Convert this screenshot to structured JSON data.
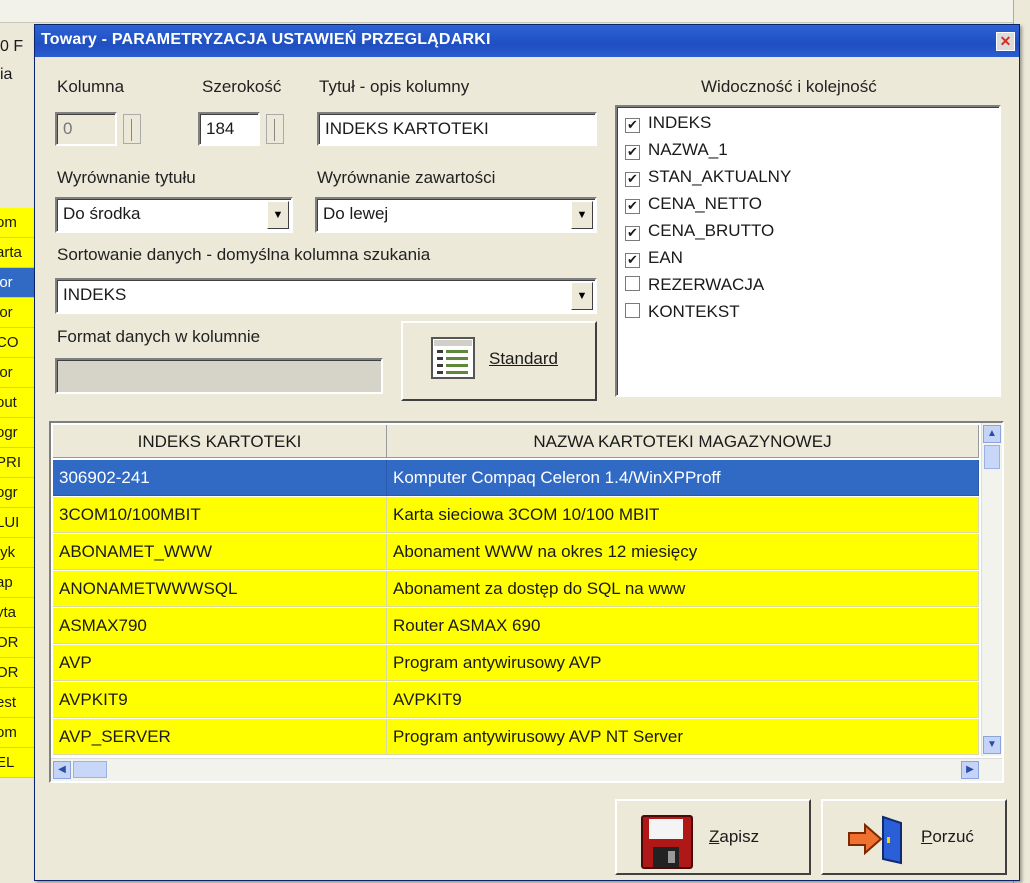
{
  "background": {
    "left_cells": [
      "om",
      "arta",
      "ior",
      "ior",
      "CO",
      "ior",
      "out",
      "ogr",
      "PRI",
      "ogr",
      "LUI",
      "tyk",
      "ap",
      "yta",
      "OR",
      "OR",
      "est",
      "om",
      "EL"
    ],
    "left_top": [
      "0 F",
      "ia"
    ]
  },
  "dialog": {
    "title": "Towary - PARAMETRYZACJA USTAWIEŃ PRZEGLĄDARKI",
    "close_glyph": "✕"
  },
  "form": {
    "kolumna_label": "Kolumna",
    "kolumna_value": "0",
    "szerokosc_label": "Szerokość",
    "szerokosc_value": "184",
    "tytul_label": "Tytuł - opis kolumny",
    "tytul_value": "INDEKS KARTOTEKI",
    "wyrownanie_tytulu_label": "Wyrównanie tytułu",
    "wyrownanie_tytulu_value": "Do środka",
    "wyrownanie_zawartosci_label": "Wyrównanie zawartości",
    "wyrownanie_zawartosci_value": "Do lewej",
    "sortowanie_label": "Sortowanie danych - domyślna kolumna szukania",
    "sortowanie_value": "INDEKS",
    "format_label": "Format danych w kolumnie",
    "format_value": "",
    "standard_button": "Standard"
  },
  "visibility": {
    "label": "Widoczność i kolejność",
    "items": [
      {
        "name": "INDEKS",
        "checked": true
      },
      {
        "name": "NAZWA_1",
        "checked": true
      },
      {
        "name": "STAN_AKTUALNY",
        "checked": true
      },
      {
        "name": "CENA_NETTO",
        "checked": true
      },
      {
        "name": "CENA_BRUTTO",
        "checked": true
      },
      {
        "name": "EAN",
        "checked": true
      },
      {
        "name": "REZERWACJA",
        "checked": false
      },
      {
        "name": "KONTEKST",
        "checked": false
      }
    ]
  },
  "grid": {
    "columns": [
      "INDEKS KARTOTEKI",
      "NAZWA KARTOTEKI MAGAZYNOWEJ"
    ],
    "rows": [
      [
        "306902-241",
        "Komputer Compaq Celeron 1.4/WinXPProff"
      ],
      [
        "3COM10/100MBIT",
        "Karta sieciowa 3COM 10/100 MBIT"
      ],
      [
        "ABONAMET_WWW",
        "Abonament WWW na okres 12 miesięcy"
      ],
      [
        "ANONAMETWWWSQL",
        "Abonament za dostęp do SQL na www"
      ],
      [
        "ASMAX790",
        "Router ASMAX 690"
      ],
      [
        "AVP",
        "Program antywirusowy AVP"
      ],
      [
        "AVPKIT9",
        "AVPKIT9"
      ],
      [
        "AVP_SERVER",
        "Program antywirusowy AVP NT Server"
      ]
    ],
    "selected_row": 0
  },
  "buttons": {
    "save": "Zapisz",
    "cancel": "Porzuć"
  },
  "colors": {
    "row_bg": "#ffff00",
    "selected_bg": "#316ac5",
    "title_bar": "#2456c8"
  }
}
